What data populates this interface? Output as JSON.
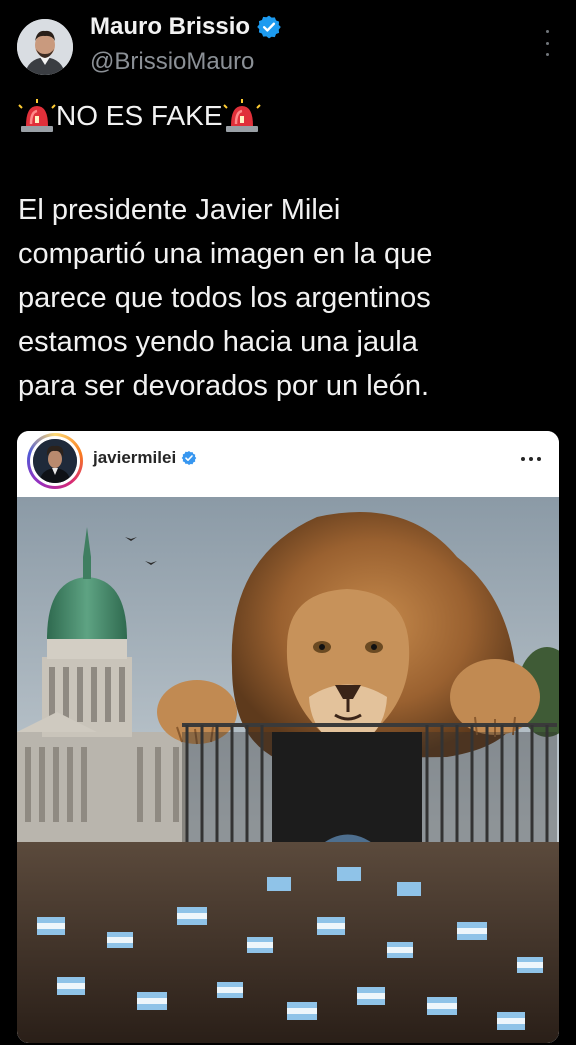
{
  "tweet": {
    "author": {
      "display_name": "Mauro Brissio",
      "handle": "@BrissioMauro",
      "verified": true,
      "avatar_icon": "profile-photo"
    },
    "headline": "NO ES FAKE",
    "headline_icon": "police-siren-icon",
    "body_lines": [
      "El presidente Javier Milei",
      "compartió una imagen en la que",
      "parece que todos los argentinos",
      "estamos yendo hacia una jaula",
      "para ser devorados por un león."
    ]
  },
  "embed": {
    "platform": "instagram",
    "username": "javiermilei",
    "verified": true,
    "image_icon": "lion-cage-illustration"
  },
  "colors": {
    "background": "#000000",
    "text": "#f2f2f2",
    "handle": "#8b9096",
    "verified_blue": "#1d9bf0",
    "siren_red": "#e0303a"
  }
}
